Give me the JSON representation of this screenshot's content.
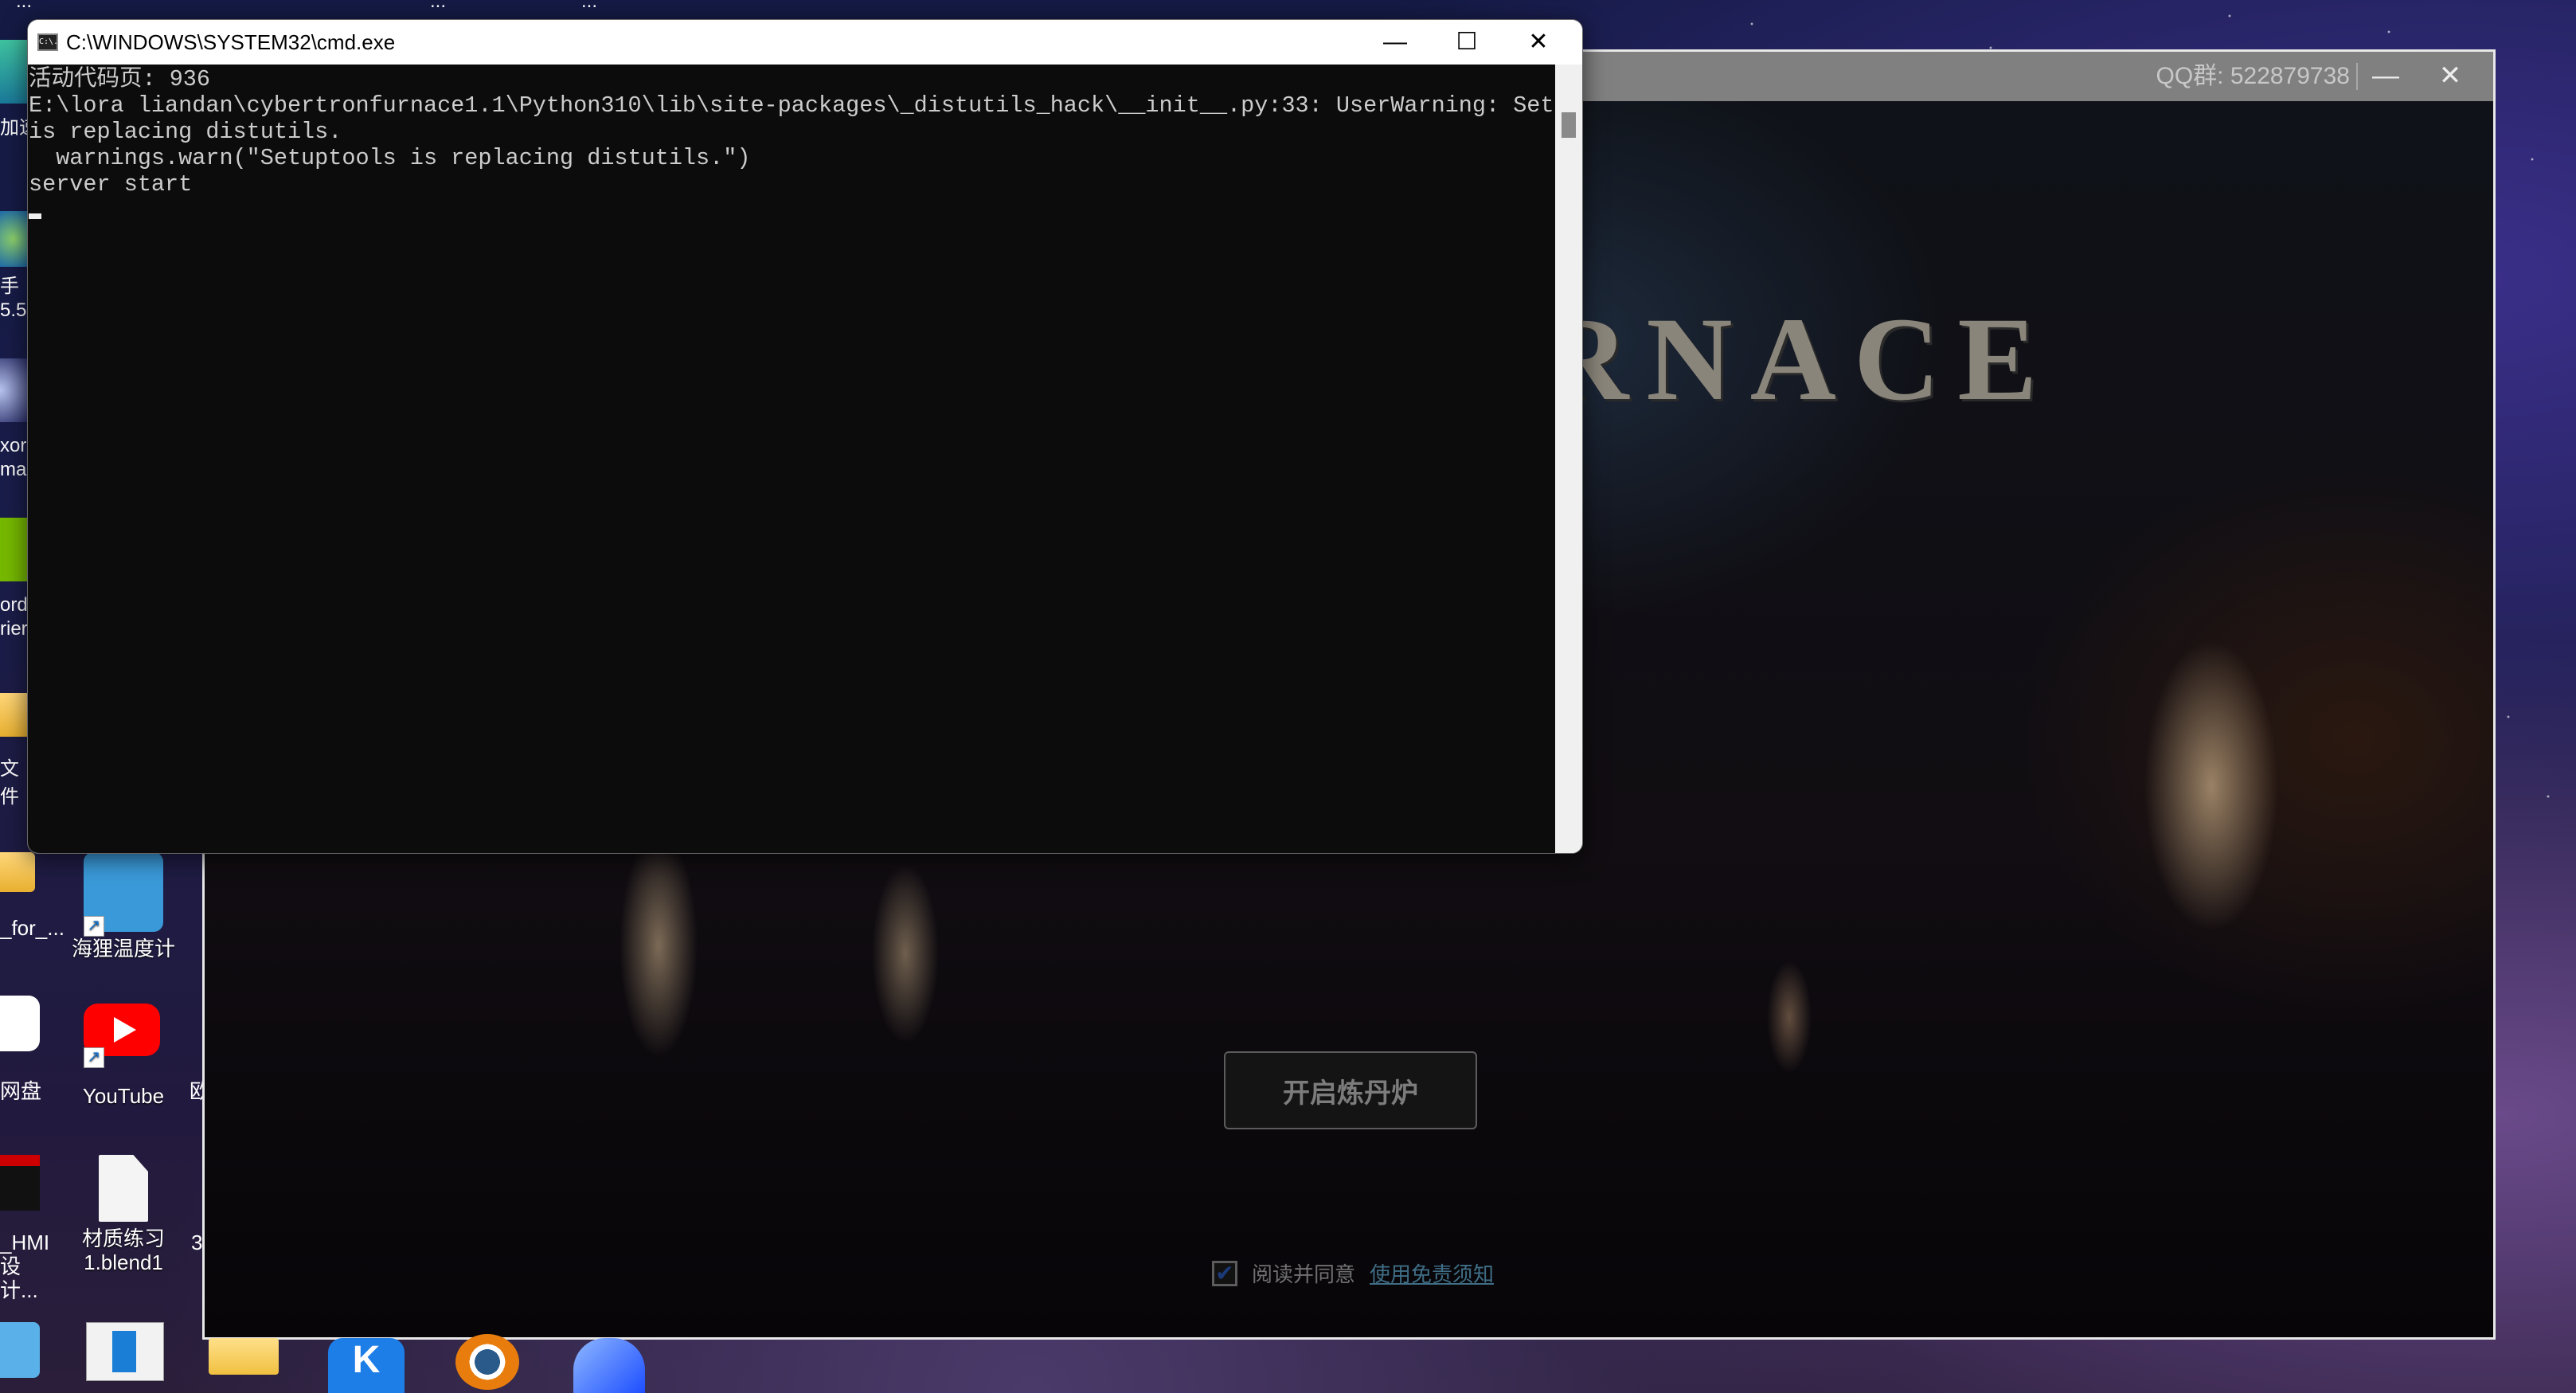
{
  "desktop": {
    "top_partial_labels": [
      "...",
      "...",
      "..."
    ],
    "left_column_labels": [
      "加速",
      "手 5.5",
      "xor ma",
      "ord rier",
      "文件"
    ],
    "icons": [
      {
        "label": "_for_...",
        "icon": "folder-icon"
      },
      {
        "label": "海狸温度计",
        "icon": "thermometer-app-icon"
      },
      {
        "label": "网盘",
        "icon": "cloud-drive-icon"
      },
      {
        "label": "YouTube",
        "icon": "youtube-icon"
      },
      {
        "label": "欧",
        "icon": "partial-icon"
      },
      {
        "label": "_HMI 设计...",
        "icon": "pdf-edge-icon"
      },
      {
        "label": "材质练习 1.blend1",
        "icon": "file-icon"
      },
      {
        "label": "3",
        "icon": "partial-icon"
      }
    ],
    "bottom_icons": [
      "workflow-app-icon",
      "window-app-icon",
      "folder-icon",
      "kuaishou-icon",
      "blender-icon",
      "cloud-app-icon"
    ]
  },
  "cmd_window": {
    "title": "C:\\WINDOWS\\SYSTEM32\\cmd.exe",
    "icon_text": "C:\\.",
    "minimize": "—",
    "maximize": "☐",
    "close": "✕",
    "lines": [
      "活动代码页: 936",
      "E:\\lora liandan\\cybertronfurnace1.1\\Python310\\lib\\site-packages\\_distutils_hack\\__init__.py:33: UserWarning: Setuptools",
      "is replacing distutils.",
      "  warnings.warn(\"Setuptools is replacing distutils.\")",
      "server start"
    ]
  },
  "app_window": {
    "qq_group": "QQ群: 522879738",
    "minimize": "—",
    "close": "✕",
    "logo_text": "RNACE",
    "start_button": "开启炼丹炉",
    "agree_checked": true,
    "agree_text": "阅读并同意",
    "disclaimer_link": "使用免责须知"
  }
}
